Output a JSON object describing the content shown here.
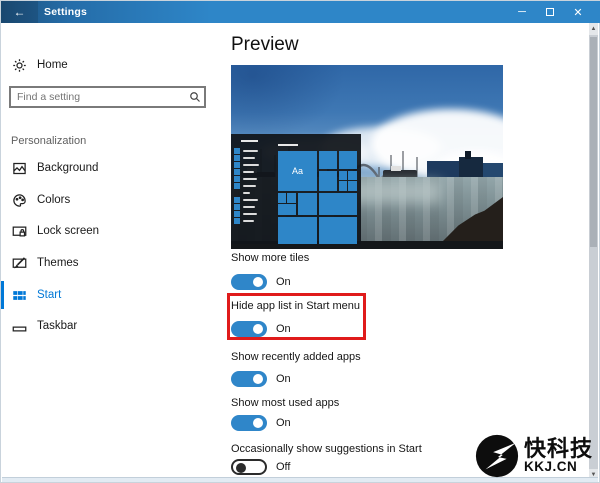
{
  "titlebar": {
    "title": "Settings",
    "back_glyph": "←",
    "minimize_glyph": "─",
    "close_glyph": "✕"
  },
  "sidebar": {
    "home_label": "Home",
    "search_placeholder": "Find a setting",
    "section_label": "Personalization",
    "items": [
      {
        "label": "Background",
        "icon": "background-image-icon",
        "selected": false
      },
      {
        "label": "Colors",
        "icon": "colors-palette-icon",
        "selected": false
      },
      {
        "label": "Lock screen",
        "icon": "lock-screen-icon",
        "selected": false
      },
      {
        "label": "Themes",
        "icon": "themes-icon",
        "selected": false
      },
      {
        "label": "Start",
        "icon": "start-grid-icon",
        "selected": true
      },
      {
        "label": "Taskbar",
        "icon": "taskbar-icon",
        "selected": false
      }
    ]
  },
  "main": {
    "heading": "Preview",
    "preview": {
      "aa_tile": "Aa"
    },
    "toggles": [
      {
        "label": "Show more tiles",
        "state_label": "On",
        "is_off": false,
        "highlighted": false
      },
      {
        "label": "Hide app list in Start menu",
        "state_label": "On",
        "is_off": false,
        "highlighted": true
      },
      {
        "label": "Show recently added apps",
        "state_label": "On",
        "is_off": false,
        "highlighted": false
      },
      {
        "label": "Show most used apps",
        "state_label": "On",
        "is_off": false,
        "highlighted": false
      },
      {
        "label": "Occasionally show suggestions in Start",
        "state_label": "Off",
        "is_off": true,
        "highlighted": false
      }
    ]
  },
  "watermark": {
    "cn": "快科技",
    "domain": "KKJ.CN"
  },
  "colors": {
    "accent": "#0078d7",
    "titlebar": "#2e86c8",
    "toggle_on": "#2f86c9",
    "highlight_red": "#e01b1b",
    "tile_blue": "#2e86c8"
  }
}
